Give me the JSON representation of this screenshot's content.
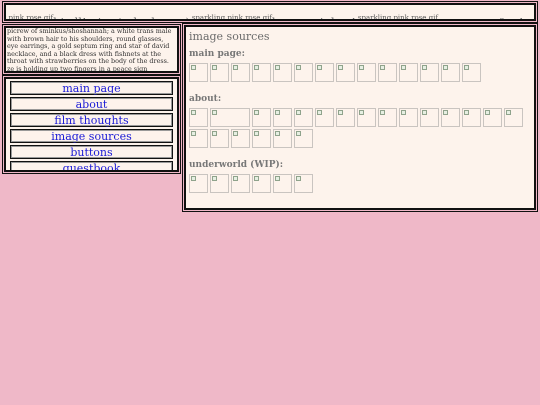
{
  "marquee": {
    "items": [
      {
        "type": "img",
        "alt": "sparkling pink rose gif"
      },
      {
        "type": "text",
        "text": "hi all! nice to be here :)"
      },
      {
        "type": "img",
        "alt": "sparkling pink rose gif"
      },
      {
        "type": "text",
        "text": "love, sminkus!"
      },
      {
        "type": "img",
        "alt": "sparkling pink rose gif"
      },
      {
        "type": "text",
        "text": "здравствуйте! приятно быть здесь"
      }
    ]
  },
  "picrew": {
    "alt": "picrew of sminkus/shoshannah; a white trans male with brown hair to his shoulders, round glasses, eye earrings, a gold septum ring and star of david necklace, and a black dress with fishnets at the throat with strawberries on the body of the dress. ze is holding up two fingers in a peace sign gesture. the picrew is from itslillyillustrates"
  },
  "nav": {
    "items": [
      {
        "label": "main page"
      },
      {
        "label": "about"
      },
      {
        "label": "film thoughts"
      },
      {
        "label": "image sources"
      },
      {
        "label": "buttons"
      },
      {
        "label": "guestbook"
      }
    ]
  },
  "content": {
    "title": "image sources",
    "sections": [
      {
        "label": "main page:",
        "count": 14,
        "wide": []
      },
      {
        "label": "about:",
        "count": 21,
        "wide": [
          1
        ]
      },
      {
        "label": "underworld (WIP):",
        "count": 6,
        "wide": []
      }
    ]
  }
}
